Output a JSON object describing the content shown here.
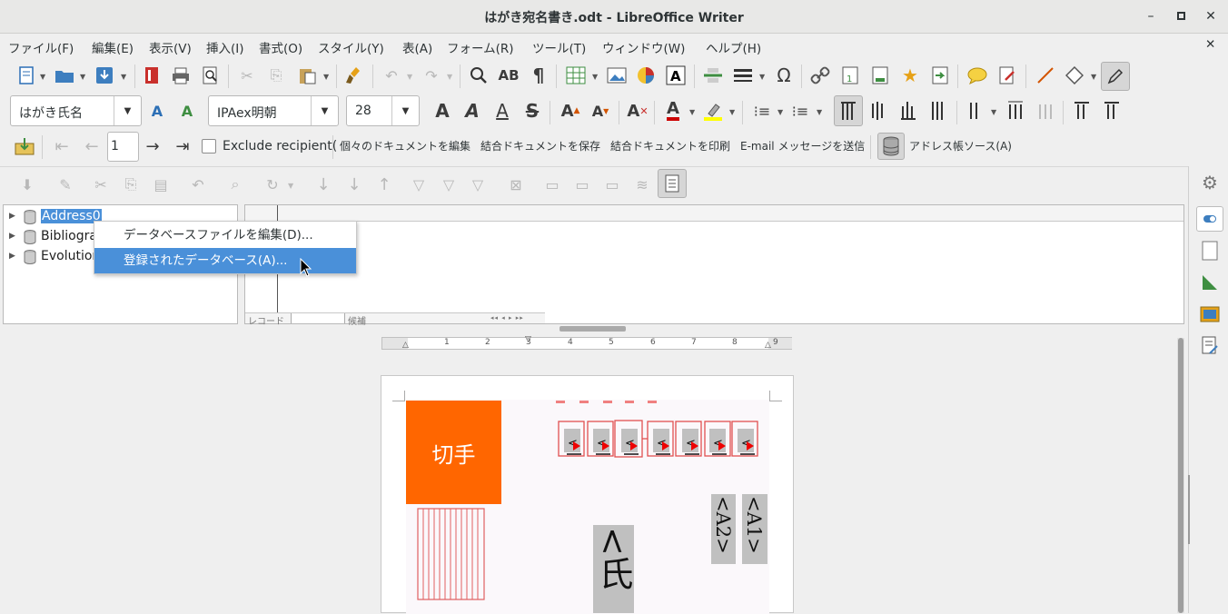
{
  "window": {
    "title": "はがき宛名書き.odt - LibreOffice Writer",
    "minimize_icon": "minimize-icon",
    "maximize_icon": "maximize-icon",
    "close_icon": "close-icon"
  },
  "menubar": {
    "items": [
      "ファイル(F)",
      "編集(E)",
      "表示(V)",
      "挿入(I)",
      "書式(O)",
      "スタイル(Y)",
      "表(A)",
      "フォーム(R)",
      "ツール(T)",
      "ウィンドウ(W)",
      "ヘルプ(H)"
    ],
    "close_doc_icon": "close-icon"
  },
  "formatting": {
    "paragraph_style": "はがき氏名",
    "font_name": "IPAex明朝",
    "font_size": "28"
  },
  "mailmerge": {
    "record_number": "1",
    "exclude_recipient": "Exclude recipient(",
    "edit_individual": "個々のドキュメントを編集",
    "save_merged": "結合ドキュメントを保存",
    "print_merged": "結合ドキュメントを印刷",
    "send_email": "E-mail メッセージを送信",
    "address_source": "アドレス帳ソース(A)"
  },
  "db_tree": {
    "items": [
      "Address0",
      "Bibliogra",
      "Evolution"
    ]
  },
  "context_menu": {
    "items": [
      "データベースファイルを編集(D)...",
      "登録されたデータベース(A)..."
    ]
  },
  "grid_footer": {
    "record_label": "レコード",
    "candidate_label": "候補"
  },
  "ruler": {
    "numbers": [
      "1",
      "2",
      "3",
      "4",
      "5",
      "6",
      "7",
      "8",
      "9"
    ]
  },
  "document": {
    "stamp_label": "切手",
    "name_field": "<氏",
    "addr1_field": "<A1>",
    "addr2_field": "<A2>",
    "colors": {
      "stamp": "#ff6600",
      "zip_box": "#e05050",
      "arrow": "#ee0000"
    }
  },
  "colors": {
    "selection": "#4a90d9",
    "font_color": "#cc0000",
    "highlight": "#ffff00"
  }
}
